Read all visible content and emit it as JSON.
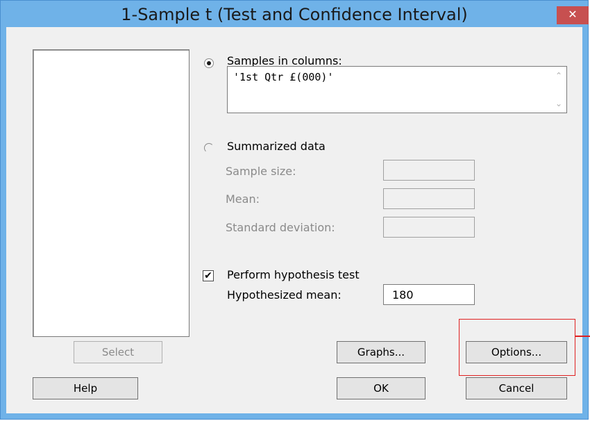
{
  "window": {
    "title": "1-Sample t (Test and Confidence Interval)",
    "close_symbol": "✕"
  },
  "samples": {
    "radio_label": "Samples in columns:",
    "selected": true,
    "columns_value": "'1st Qtr £(000)'"
  },
  "summarized": {
    "radio_label": "Summarized data",
    "selected": false,
    "sample_size_label": "Sample size:",
    "mean_label": "Mean:",
    "std_dev_label": "Standard deviation:",
    "sample_size_value": "",
    "mean_value": "",
    "std_dev_value": ""
  },
  "hypothesis": {
    "checkbox_label": "Perform hypothesis test",
    "checked": true,
    "check_symbol": "✔",
    "mean_label": "Hypothesized mean:",
    "mean_value": "180"
  },
  "buttons": {
    "select": "Select",
    "graphs": "Graphs...",
    "options": "Options...",
    "help": "Help",
    "ok": "OK",
    "cancel": "Cancel"
  },
  "colors": {
    "title_bar": "#6fb2e8",
    "close": "#c75050",
    "highlight": "#e02020"
  }
}
